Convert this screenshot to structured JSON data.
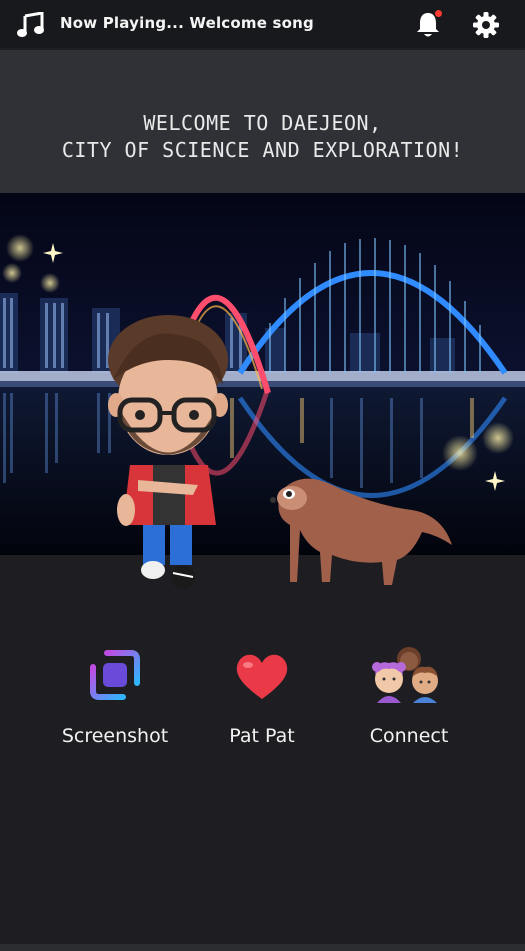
{
  "topbar": {
    "now_playing": "Now Playing... Welcome song",
    "music_icon": "music-note-icon",
    "bell_icon": "bell-icon",
    "settings_icon": "gear-icon",
    "notification_dot_color": "#ff3b30"
  },
  "banner": {
    "line1": "WELCOME TO DAEJEON,",
    "line2": "CITY OF SCIENCE AND EXPLORATION!"
  },
  "actions": [
    {
      "label": "Screenshot",
      "icon": "screenshot-icon"
    },
    {
      "label": "Pat Pat",
      "icon": "heart-icon"
    },
    {
      "label": "Connect",
      "icon": "friends-icon"
    }
  ],
  "colors": {
    "background": "#1e1e22",
    "topbar": "#18191d",
    "banner": "#2f3136",
    "bridge_arch": "#2f8bff",
    "red_arch": "#ff4d6d"
  }
}
